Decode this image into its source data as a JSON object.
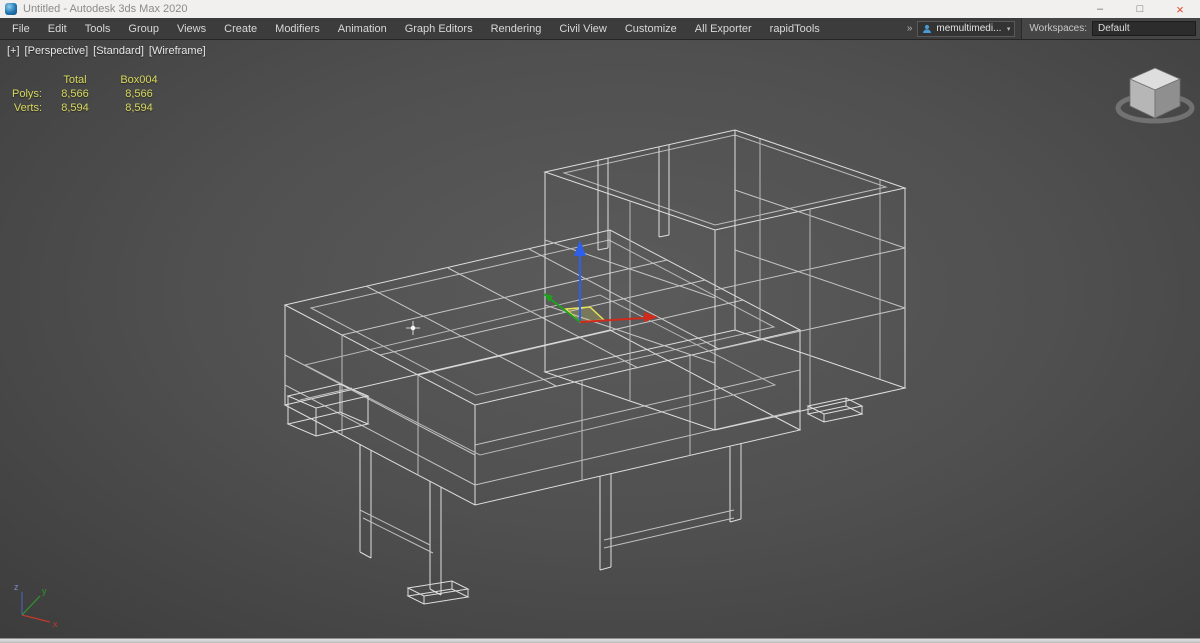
{
  "window": {
    "title": "Untitled - Autodesk 3ds Max 2020",
    "controls": {
      "minimize": "–",
      "maximize": "□",
      "close": "×"
    }
  },
  "menu": {
    "items": [
      "File",
      "Edit",
      "Tools",
      "Group",
      "Views",
      "Create",
      "Modifiers",
      "Animation",
      "Graph Editors",
      "Rendering",
      "Civil View",
      "Customize",
      "All Exporter",
      "rapidTools"
    ],
    "overflow": "»"
  },
  "account": {
    "name": "memultimedi...",
    "arrow": "▾"
  },
  "workspaces": {
    "label": "Workspaces:",
    "selected": "Default"
  },
  "viewport": {
    "labels": {
      "plus": "[+]",
      "view": "[Perspective]",
      "standard": "[Standard]",
      "shading": "[Wireframe]"
    },
    "stats": {
      "columns": {
        "total": "Total",
        "object": "Box004"
      },
      "rows": [
        {
          "label": "Polys:",
          "total": "8,566",
          "object": "8,566"
        },
        {
          "label": "Verts:",
          "total": "8,594",
          "object": "8,594"
        }
      ]
    },
    "axis_labels": {
      "x": "x",
      "y": "y",
      "z": "z"
    }
  },
  "colors": {
    "gizmo_x_axis": "#cf2a1b",
    "gizmo_y_axis": "#1fa01f",
    "gizmo_z_axis": "#2e5fe8",
    "gizmo_plane": "#e8e25a",
    "stats_text": "#d9d95c",
    "wireframe": "#e6e6e6",
    "close_button": "#e8442c"
  }
}
